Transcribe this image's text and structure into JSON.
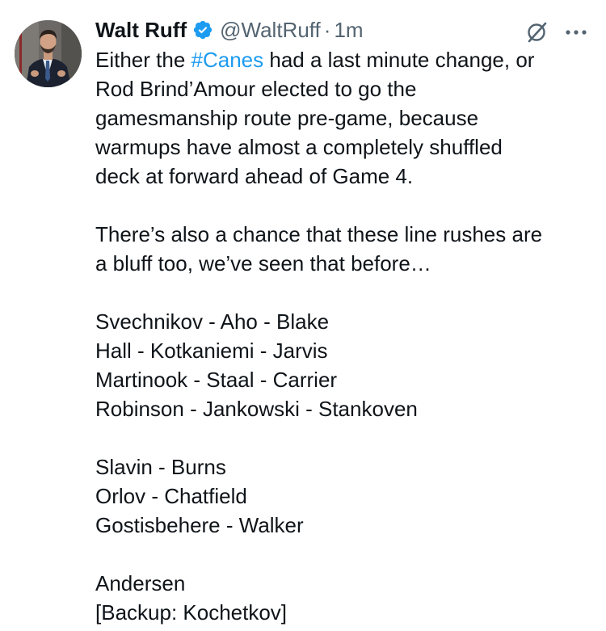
{
  "tweet": {
    "author": {
      "name": "Walt Ruff",
      "handle": "@WaltRuff",
      "separator": "·",
      "time": "1m",
      "avatar_icon": "profile-photo",
      "verified_icon": "verified-badge-icon"
    },
    "actions": {
      "grok_icon": "grok-icon",
      "more_icon": "more-options-icon"
    },
    "colors": {
      "link": "#1d9bf0",
      "text": "#0f1419",
      "muted": "#536471"
    },
    "text": {
      "p1_before_hashtag": "Either the ",
      "hashtag": "#Canes",
      "p1_after_hashtag": " had a last minute change, or",
      "p1_lines": [
        "Rod Brind’Amour elected to go the",
        "gamesmanship route pre-game, because",
        "warmups have almost a completely shuffled",
        "deck at forward ahead of Game 4."
      ],
      "p2_lines": [
        "There’s also a chance that these line rushes are",
        "a bluff too, we’ve seen that before…"
      ],
      "forwards": [
        "Svechnikov - Aho - Blake",
        "Hall - Kotkaniemi - Jarvis",
        "Martinook - Staal - Carrier",
        "Robinson - Jankowski - Stankoven"
      ],
      "defense": [
        "Slavin - Burns",
        "Orlov - Chatfield",
        "Gostisbehere - Walker"
      ],
      "goalies": [
        "Andersen",
        "[Backup: Kochetkov]"
      ]
    }
  }
}
